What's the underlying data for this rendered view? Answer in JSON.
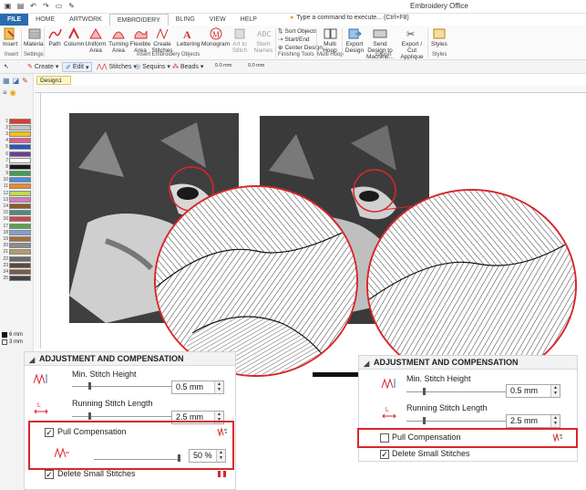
{
  "window": {
    "title": "Embroidery Office"
  },
  "ribbon_tabs": [
    "FILE",
    "HOME",
    "ARTWORK",
    "EMBROIDERY",
    "BLING",
    "VIEW",
    "HELP"
  ],
  "tell_me": "Type a command to execute... (Ctrl+F8)",
  "ribbon": {
    "insert": "Insert",
    "material": "Material",
    "path": "Path",
    "column": "Column",
    "uniform_area": "Uniform Area",
    "turning_area": "Turning Area",
    "flexible_area": "Flexible Area",
    "create_stitches": "Create Stitches",
    "lettering": "Lettering",
    "monogram": "Monogram",
    "art_to_stitch": "Art to Stitch",
    "stem_names": "Stem Names",
    "sort_objects": "Sort Objects",
    "start_end": "Start/End",
    "center_design": "Center Design",
    "multi_hoop": "Multi Hoop",
    "export_design": "Export Design",
    "send_design": "Send Design to Machine...",
    "export_cut": "Export / Cut Applique",
    "styles": "Styles",
    "groups": [
      "Insert",
      "Settings",
      "Insert Embroidery Objects",
      "Finishing Tools",
      "Multi Hoop",
      "Export",
      "Styles"
    ]
  },
  "toolbar2": {
    "create": "Create",
    "edit": "Edit",
    "stitches": "Stitches",
    "sequins": "Sequins",
    "beads": "Beads",
    "val1": "0.0 mm",
    "val2": "0.0 mm",
    "val3": "0.0 mm",
    "val4": "0.0 mm"
  },
  "document_tab": "Design1",
  "palette_numbers": [
    "1",
    "2",
    "3",
    "4",
    "5",
    "6",
    "7",
    "8",
    "9",
    "10",
    "11",
    "12",
    "13",
    "14",
    "15",
    "16",
    "17",
    "18",
    "19",
    "20",
    "21",
    "22",
    "23",
    "24",
    "25"
  ],
  "toolbox_values": {
    "v1": "6 mm",
    "v2": "3 mm"
  },
  "colors": {
    "accent": "#d9262c",
    "palette": [
      "#e03a2e",
      "#c5c5c5",
      "#f2c318",
      "#e05a8e",
      "#2a56b8",
      "#6b3f98",
      "#ffffff",
      "#1a1a1a",
      "#3ea14d",
      "#4b8fd6",
      "#e98c2f",
      "#c3d94b",
      "#d67ab8",
      "#8a5b2f",
      "#4e8a7a",
      "#c94a4a",
      "#5ca04e",
      "#79a3cf",
      "#a56f3f",
      "#8c8c8c",
      "#b89a68",
      "#6a6a6a",
      "#5c4a3a",
      "#7c5b4a",
      "#444444"
    ]
  },
  "panel_left": {
    "title": "ADJUSTMENT AND COMPENSATION",
    "min_stitch_height": {
      "label": "Min. Stitch Height",
      "value": "0.5 mm"
    },
    "running_stitch_length": {
      "label": "Running Stitch Length",
      "value": "2.5 mm"
    },
    "pull_compensation": {
      "label": "Pull Compensation",
      "checked": true,
      "value": "50 %"
    },
    "delete_small_stitches": {
      "label": "Delete Small Stitches",
      "checked": true
    }
  },
  "panel_right": {
    "title": "ADJUSTMENT AND COMPENSATION",
    "min_stitch_height": {
      "label": "Min. Stitch Height",
      "value": "0.5 mm"
    },
    "running_stitch_length": {
      "label": "Running Stitch Length",
      "value": "2.5 mm"
    },
    "pull_compensation": {
      "label": "Pull Compensation",
      "checked": false
    },
    "delete_small_stitches": {
      "label": "Delete Small Stitches",
      "checked": true
    }
  }
}
